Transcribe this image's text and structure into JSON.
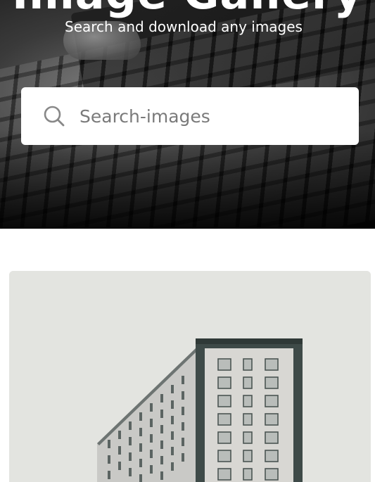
{
  "hero": {
    "title": "Image Gallery",
    "subtitle": "Search and download any images"
  },
  "search": {
    "placeholder": "Search-images",
    "value": "",
    "icon": "search-icon"
  },
  "results": {
    "items": [
      {
        "icon": "building-photo",
        "alt": ""
      }
    ]
  },
  "colors": {
    "search_bg": "#ffffff",
    "placeholder": "#7a7a7a",
    "card_bg": "#e3e4e0"
  }
}
